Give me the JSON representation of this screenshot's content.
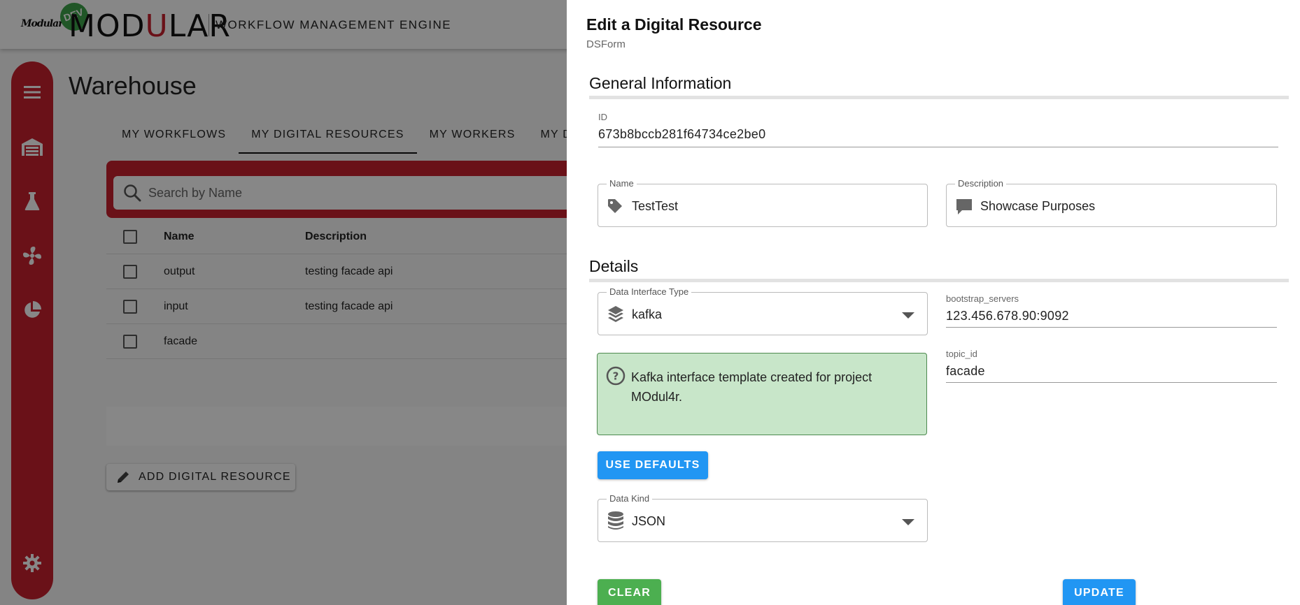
{
  "app": {
    "small_logo": "Modular",
    "env_badge": "DEV",
    "brand_pre": "MOD",
    "brand_accent": "U",
    "brand_post": "LAR",
    "subtitle": "WORKFLOW MANAGEMENT ENGINE"
  },
  "sidebar": {
    "icons": [
      "menu-icon",
      "warehouse-icon",
      "flask-icon",
      "fan-icon",
      "pie-chart-icon",
      "gear-icon"
    ]
  },
  "page": {
    "title": "Warehouse",
    "tabs": [
      "MY WORKFLOWS",
      "MY DIGITAL RESOURCES",
      "MY WORKERS",
      "MY DAT"
    ],
    "active_tab": "MY DIGITAL RESOURCES",
    "search_placeholder": "Search by Name",
    "table": {
      "headers": [
        "Name",
        "Description"
      ],
      "rows": [
        {
          "name": "output",
          "description": "testing facade api"
        },
        {
          "name": "input",
          "description": "testing facade api"
        },
        {
          "name": "facade",
          "description": ""
        }
      ]
    },
    "add_button": "ADD DIGITAL RESOURCE"
  },
  "drawer": {
    "title": "Edit a Digital Resource",
    "subtitle": "DSForm",
    "general": {
      "heading": "General Information",
      "id_label": "ID",
      "id_value": "673b8bccb281f64734ce2be0",
      "name_label": "Name",
      "name_value": "TestTest",
      "desc_label": "Description",
      "desc_value": "Showcase Purposes"
    },
    "details": {
      "heading": "Details",
      "interface_label": "Data Interface Type",
      "interface_value": "kafka",
      "bootstrap_label": "bootstrap_servers",
      "bootstrap_value": "123.456.678.90:9092",
      "topic_label": "topic_id",
      "topic_value": "facade",
      "info_text": "Kafka interface template created for project MOdul4r.",
      "use_defaults": "USE DEFAULTS",
      "kind_label": "Data Kind",
      "kind_value": "JSON"
    },
    "clear_button": "CLEAR",
    "update_button": "UPDATE"
  },
  "colors": {
    "brand_red": "#c8202f",
    "badge_green": "#3da34a",
    "button_blue": "#2196f3",
    "button_green": "#4caf50",
    "alert_bg": "#c8e6c9"
  }
}
